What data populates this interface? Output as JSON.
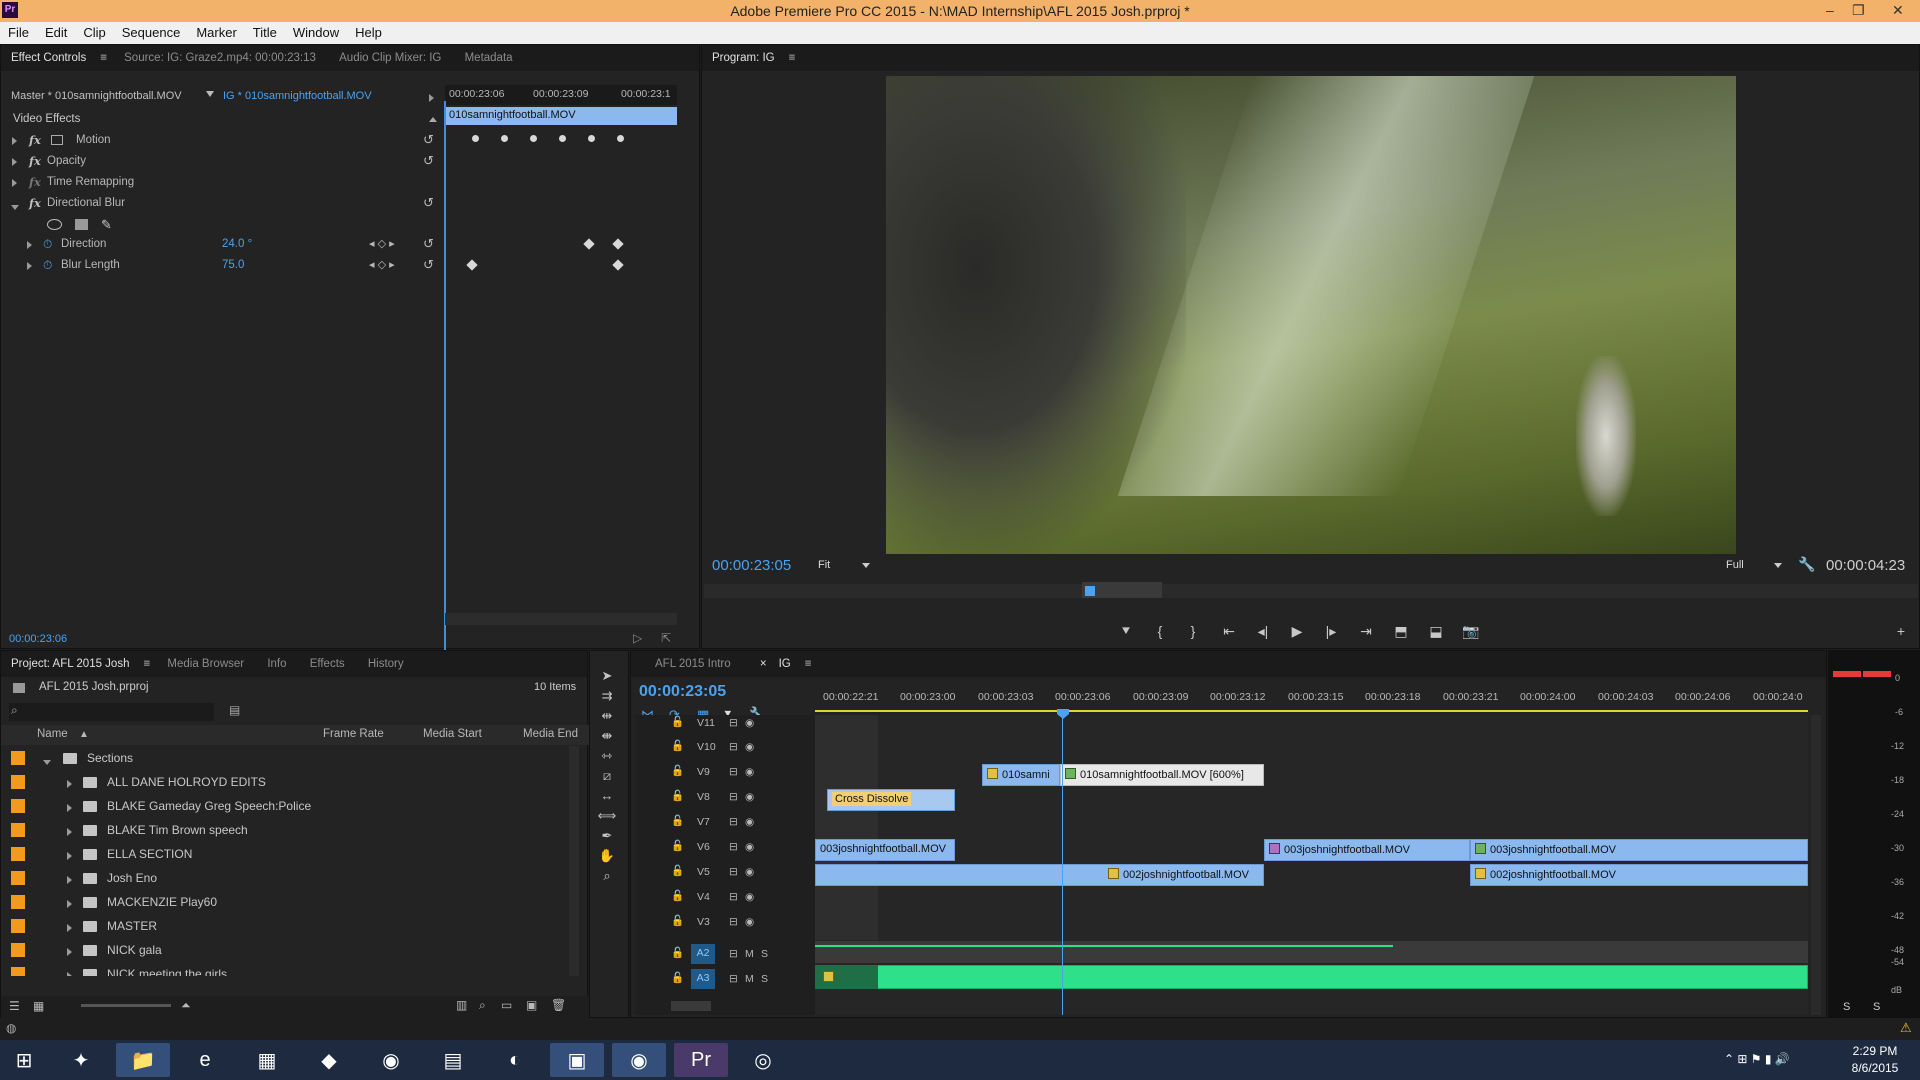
{
  "window": {
    "title": "Adobe Premiere Pro CC 2015 - N:\\MAD Internship\\AFL 2015 Josh.prproj *",
    "logo": "Pr"
  },
  "menu": [
    "File",
    "Edit",
    "Clip",
    "Sequence",
    "Marker",
    "Title",
    "Window",
    "Help"
  ],
  "effect_controls": {
    "tabs": [
      "Effect Controls",
      "Source: IG: Graze2.mp4: 00:00:23:13",
      "Audio Clip Mixer: IG",
      "Metadata"
    ],
    "master": "Master * 010samnightfootball.MOV",
    "clip": "IG * 010samnightfootball.MOV",
    "ruler_times": [
      "00:00:23:06",
      "00:00:23:09",
      "00:00:23:1"
    ],
    "clip_bar": "010samnightfootball.MOV",
    "section": "Video Effects",
    "effects": [
      "Motion",
      "Opacity",
      "Time Remapping",
      "Directional Blur"
    ],
    "params": [
      {
        "name": "Direction",
        "value": "24.0 °"
      },
      {
        "name": "Blur Length",
        "value": "75.0"
      }
    ],
    "timecode": "00:00:23:06"
  },
  "program": {
    "tab": "Program: IG",
    "timecode": "00:00:23:05",
    "fit": "Fit",
    "full": "Full",
    "duration": "00:00:04:23"
  },
  "project": {
    "tabs": [
      "Project: AFL 2015 Josh",
      "Media Browser",
      "Info",
      "Effects",
      "History"
    ],
    "file": "AFL 2015 Josh.prproj",
    "items_count": "10 Items",
    "columns": [
      "Name",
      "Frame Rate",
      "Media Start",
      "Media End"
    ],
    "root": "Sections",
    "folders": [
      "ALL DANE HOLROYD EDITS",
      "BLAKE Gameday Greg Speech:Police",
      "BLAKE Tim Brown speech",
      "ELLA SECTION",
      "Josh Eno",
      "MACKENZIE Play60",
      "MASTER",
      "NICK gala",
      "NICK meeting the girls"
    ]
  },
  "timeline": {
    "tabs": [
      "AFL 2015 Intro",
      "IG"
    ],
    "timecode": "00:00:23:05",
    "ruler": [
      "00:00:22:21",
      "00:00:23:00",
      "00:00:23:03",
      "00:00:23:06",
      "00:00:23:09",
      "00:00:23:12",
      "00:00:23:15",
      "00:00:23:18",
      "00:00:23:21",
      "00:00:24:00",
      "00:00:24:03",
      "00:00:24:06",
      "00:00:24:0"
    ],
    "tracks": [
      "V11",
      "V10",
      "V9",
      "V8",
      "V7",
      "V6",
      "V5",
      "V4",
      "V3",
      "A2",
      "A3"
    ],
    "audio_flags": [
      "M",
      "S"
    ],
    "clips": {
      "v9_a": "010samni",
      "v9_b": "010samnightfootball.MOV [600%]",
      "v8": "Cross Dissolve",
      "v6_a": "003joshnightfootball.MOV",
      "v6_b": "003joshnightfootball.MOV",
      "v6_c": "003joshnightfootball.MOV",
      "v5_a": "002joshnightfootball.MOV",
      "v5_b": "002joshnightfootball.MOV"
    }
  },
  "meter": {
    "scale": [
      "0",
      "-6",
      "-12",
      "-18",
      "-24",
      "-30",
      "-36",
      "-42",
      "-48",
      "-54",
      "dB"
    ],
    "solo": [
      "S",
      "S"
    ]
  },
  "taskbar": {
    "time": "2:29 PM",
    "date": "8/6/2015"
  }
}
